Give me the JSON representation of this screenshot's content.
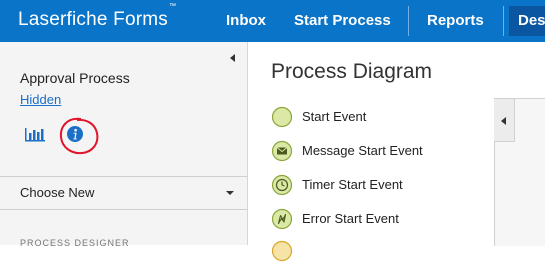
{
  "header": {
    "brand": "Laserfiche Forms",
    "trademark": "™",
    "nav": [
      "Inbox",
      "Start Process",
      "Reports",
      "Des"
    ],
    "colors": {
      "bar": "#0a74c9",
      "active": "#0a56a0"
    }
  },
  "sidebar": {
    "process_name": "Approval Process",
    "visibility_link": "Hidden",
    "icons": [
      "bar-chart-icon",
      "info-icon"
    ],
    "choose_new": "Choose New",
    "truncated_section": "PROCESS DESIGNER"
  },
  "main": {
    "title": "Process Diagram",
    "legend": [
      {
        "label": "Start Event",
        "icon": "start-event-icon"
      },
      {
        "label": "Message Start Event",
        "icon": "message-start-event-icon"
      },
      {
        "label": "Timer Start Event",
        "icon": "timer-start-event-icon"
      },
      {
        "label": "Error Start Event",
        "icon": "error-start-event-icon"
      }
    ]
  }
}
